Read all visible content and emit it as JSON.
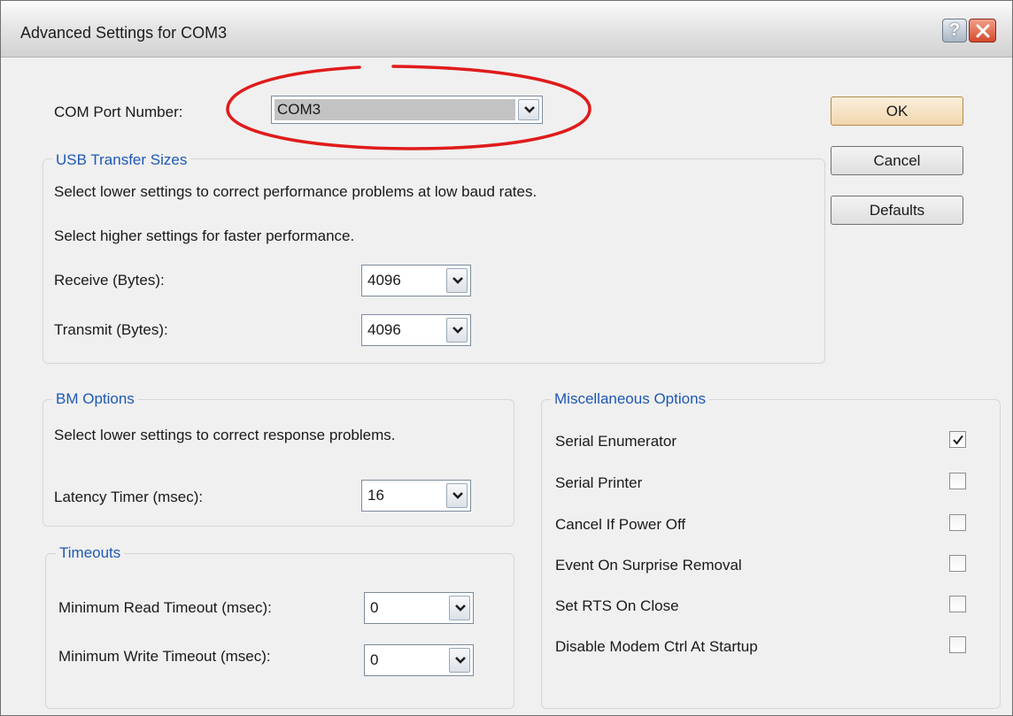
{
  "window": {
    "title": "Advanced Settings for COM3",
    "help_label": "?"
  },
  "com_port": {
    "label": "COM Port Number:",
    "value": "COM3"
  },
  "buttons": {
    "ok": "OK",
    "cancel": "Cancel",
    "defaults": "Defaults"
  },
  "usb_transfer": {
    "legend": "USB Transfer Sizes",
    "hint_low": "Select lower settings to correct performance problems at low baud rates.",
    "hint_high": "Select higher settings for faster performance.",
    "receive_label": "Receive (Bytes):",
    "receive_value": "4096",
    "transmit_label": "Transmit (Bytes):",
    "transmit_value": "4096"
  },
  "bm_options": {
    "legend": "BM Options",
    "hint": "Select lower settings to correct response problems.",
    "latency_label": "Latency Timer (msec):",
    "latency_value": "16"
  },
  "timeouts": {
    "legend": "Timeouts",
    "read_label": "Minimum Read Timeout (msec):",
    "read_value": "0",
    "write_label": "Minimum Write Timeout (msec):",
    "write_value": "0"
  },
  "misc": {
    "legend": "Miscellaneous Options",
    "options": [
      {
        "label": "Serial Enumerator",
        "checked": true
      },
      {
        "label": "Serial Printer",
        "checked": false
      },
      {
        "label": "Cancel If Power Off",
        "checked": false
      },
      {
        "label": "Event On Surprise Removal",
        "checked": false
      },
      {
        "label": "Set RTS On Close",
        "checked": false
      },
      {
        "label": "Disable Modem Ctrl At Startup",
        "checked": false
      }
    ]
  },
  "colors": {
    "legend_text": "#1d58b5",
    "annotation_ellipse": "#e01b1b",
    "default_button": "#f1d6ad"
  },
  "icons": {
    "help": "question-mark-icon",
    "close": "close-icon",
    "dropdown": "chevron-down-icon",
    "check": "checkmark-icon"
  }
}
